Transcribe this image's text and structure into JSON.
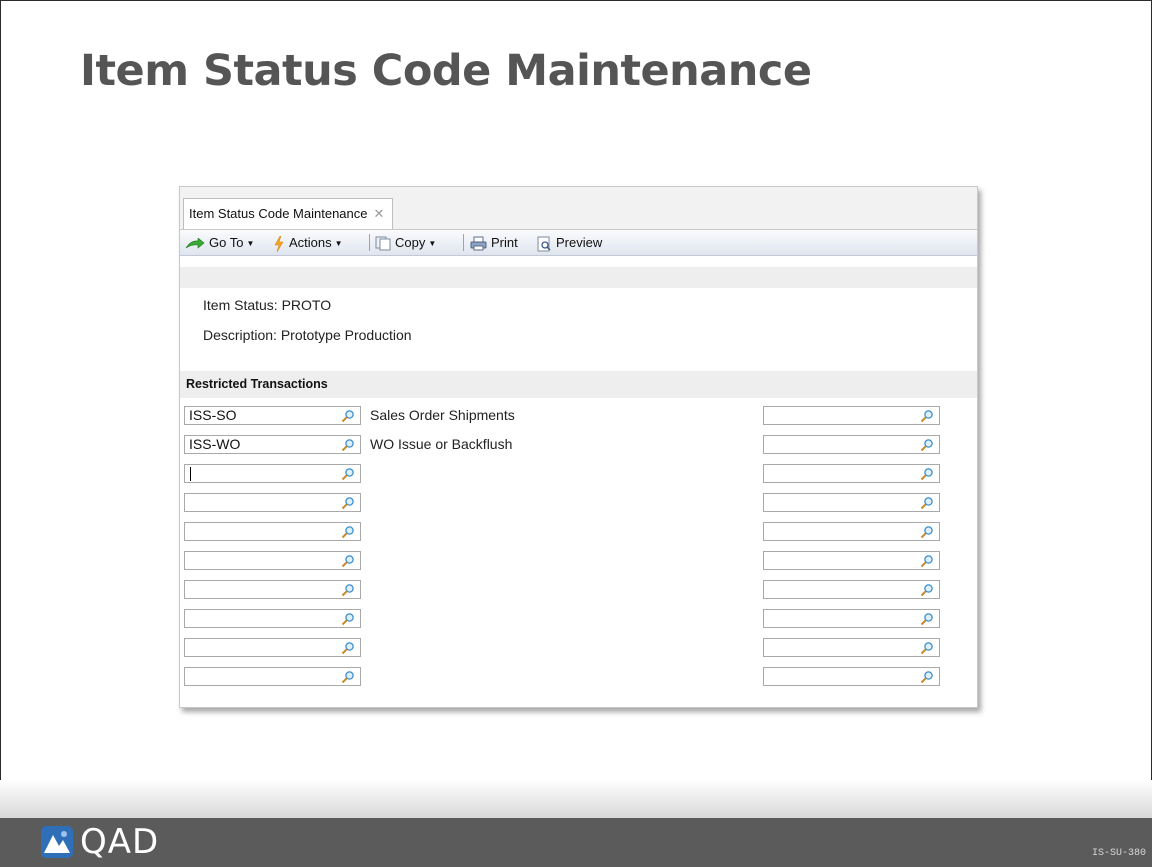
{
  "slide": {
    "title": "Item Status Code Maintenance",
    "footer_logo": "QAD",
    "footer_code": "IS-SU-380"
  },
  "window": {
    "tab_label": "Item Status Code Maintenance",
    "toolbar": {
      "goto_label": "Go To",
      "actions_label": "Actions",
      "copy_label": "Copy",
      "print_label": "Print",
      "preview_label": "Preview"
    },
    "item_status": {
      "label": "Item Status:",
      "value": "PROTO"
    },
    "description": {
      "label": "Description:",
      "value": "Prototype Production"
    },
    "section_title": "Restricted Transactions",
    "left_rows": [
      {
        "value": "ISS-SO",
        "desc": "Sales Order Shipments"
      },
      {
        "value": "ISS-WO",
        "desc": "WO Issue or Backflush"
      },
      {
        "value": "",
        "desc": ""
      },
      {
        "value": "",
        "desc": ""
      },
      {
        "value": "",
        "desc": ""
      },
      {
        "value": "",
        "desc": ""
      },
      {
        "value": "",
        "desc": ""
      },
      {
        "value": "",
        "desc": ""
      },
      {
        "value": "",
        "desc": ""
      },
      {
        "value": "",
        "desc": ""
      }
    ],
    "right_rows": [
      {
        "value": ""
      },
      {
        "value": ""
      },
      {
        "value": ""
      },
      {
        "value": ""
      },
      {
        "value": ""
      },
      {
        "value": ""
      },
      {
        "value": ""
      },
      {
        "value": ""
      },
      {
        "value": ""
      },
      {
        "value": ""
      }
    ]
  },
  "colors": {
    "title": "#555555",
    "footer": "#5b5b5b",
    "toolbar_gradient_end": "#dfe5ef"
  },
  "icons": {
    "lookup": "magnifier-icon",
    "goto": "green-arrow-icon",
    "actions": "lightning-icon",
    "copy": "copy-icon",
    "print": "printer-icon",
    "preview": "preview-icon"
  }
}
